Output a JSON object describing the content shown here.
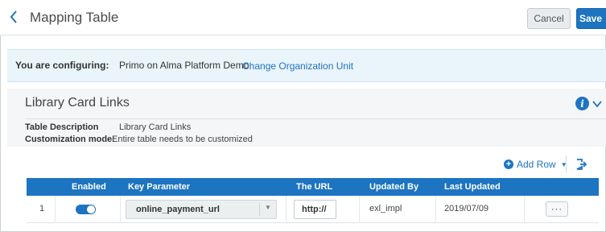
{
  "header": {
    "title": "Mapping Table",
    "cancel_label": "Cancel",
    "save_label": "Save"
  },
  "config": {
    "label": "You are configuring:",
    "value": "Primo on Alma Platform Demo",
    "link": "Change Organization Unit"
  },
  "section": {
    "title": "Library Card Links",
    "table_description_label": "Table Description",
    "table_description_value": "Library Card Links",
    "customization_label": "Customization mode:",
    "customization_value": "Entire table needs to be customized"
  },
  "toolbar": {
    "add_row_label": "Add Row"
  },
  "table": {
    "columns": [
      "Enabled",
      "Key Parameter",
      "The URL",
      "Updated By",
      "Last Updated"
    ],
    "rows": [
      {
        "index": "1",
        "enabled": true,
        "key_parameter": "online_payment_url",
        "url": "http://",
        "updated_by": "exl_impl",
        "last_updated": "2019/07/09",
        "actions_label": "···"
      }
    ]
  },
  "colors": {
    "accent": "#1d74c1",
    "config_bg": "#eaf4fb",
    "section_bg": "#f4f6f7"
  },
  "icons": [
    "back-chevron-icon",
    "info-icon",
    "chevron-down-icon",
    "plus-circle-icon",
    "export-icon",
    "more-actions-icon"
  ]
}
